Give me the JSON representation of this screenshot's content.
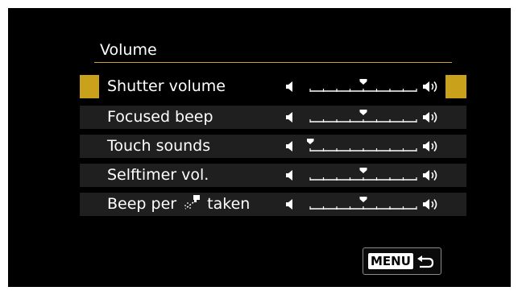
{
  "page": {
    "title": "Volume"
  },
  "items": [
    {
      "label": "Shutter volume",
      "level": 4,
      "selected": true
    },
    {
      "label": "Focused beep",
      "level": 4,
      "selected": false
    },
    {
      "label": "Touch sounds",
      "level": 0,
      "selected": false
    },
    {
      "label": "Selftimer vol.",
      "level": 4,
      "selected": false
    },
    {
      "label_prefix": "Beep per",
      "label_suffix": "taken",
      "icon": "paintbrush-icon",
      "level": 4,
      "selected": false
    }
  ],
  "scale": {
    "max": 8
  },
  "footer": {
    "menu_label": "MENU",
    "back_icon": "return-arrow-icon"
  },
  "colors": {
    "accent": "#c9a11a",
    "row_bg": "#1f1f1f"
  }
}
